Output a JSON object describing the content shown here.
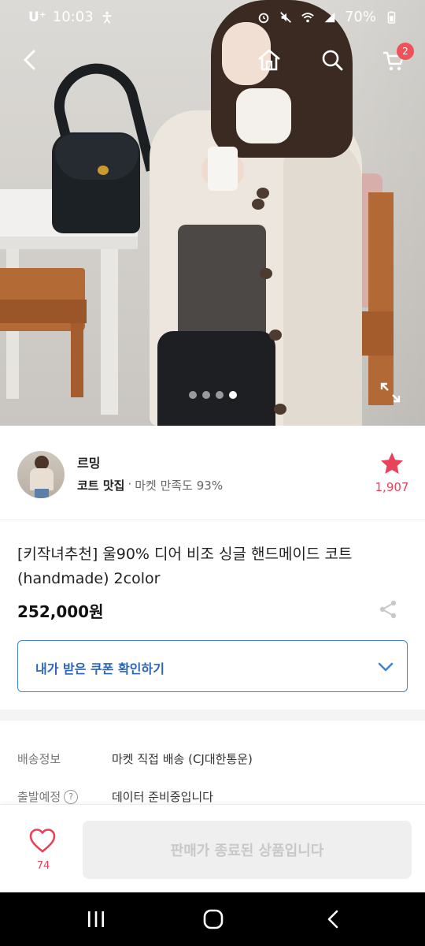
{
  "status_bar": {
    "carrier": "U⁺",
    "time": "10:03",
    "battery": "70%"
  },
  "header": {
    "cart_count": "2"
  },
  "gallery": {
    "total_images": 4,
    "active_index": 3
  },
  "seller": {
    "name": "르밍",
    "tag": "코트 맛집",
    "separator": "·",
    "satisfaction": "마켓 만족도 93%",
    "favorite_count": "1,907"
  },
  "product": {
    "title_line1": "[키작녀추천] 울90% 디어 비조 싱글 핸드메이드 코트",
    "title_line2": "(handmade) 2color",
    "price": "252,000원"
  },
  "coupon": {
    "label": "내가 받은 쿠폰 확인하기"
  },
  "info": [
    {
      "key": "배송정보",
      "value": "마켓 직접 배송 (CJ대한통운)"
    },
    {
      "key": "출발예정",
      "value": "데이터 준비중입니다",
      "help": "?"
    }
  ],
  "action_bar": {
    "like_count": "74",
    "ended_label": "판매가 종료된 상품입니다"
  },
  "colors": {
    "accent_blue": "#3f84d4",
    "accent_red": "#e8435a",
    "badge_red": "#f0525a"
  }
}
